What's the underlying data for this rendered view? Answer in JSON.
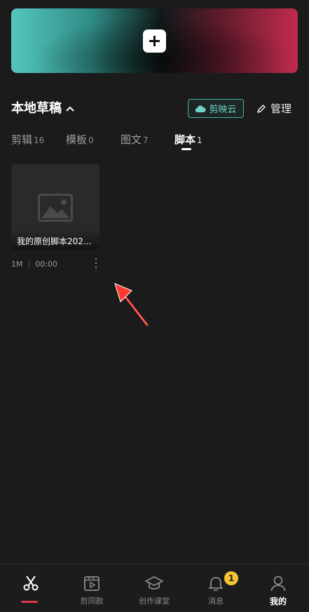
{
  "banner": {
    "create_icon": "plus-icon"
  },
  "section": {
    "title": "本地草稿",
    "toggle_icon": "chevron-up-icon",
    "cloud_button": "剪映云",
    "manage_label": "管理"
  },
  "tabs": [
    {
      "label": "剪辑",
      "count": "16",
      "active": false
    },
    {
      "label": "模板",
      "count": "0",
      "active": false
    },
    {
      "label": "图文",
      "count": "7",
      "active": false
    },
    {
      "label": "脚本",
      "count": "1",
      "active": true
    }
  ],
  "drafts": [
    {
      "name": "我的原创脚本202…",
      "size": "1M",
      "duration": "00:00"
    }
  ],
  "bottom_nav": [
    {
      "label": "",
      "icon": "scissors-icon",
      "active": true
    },
    {
      "label": "剪同款",
      "icon": "clapperboard-icon",
      "active": false
    },
    {
      "label": "创作课堂",
      "icon": "graduation-cap-icon",
      "active": false
    },
    {
      "label": "消息",
      "icon": "bell-icon",
      "active": false,
      "badge": "1"
    },
    {
      "label": "我的",
      "icon": "person-icon",
      "active": false
    }
  ],
  "colors": {
    "accent_teal": "#3fb6a6",
    "accent_red": "#e2334d",
    "badge_yellow": "#f5c431",
    "background": "#1b1b1b"
  }
}
